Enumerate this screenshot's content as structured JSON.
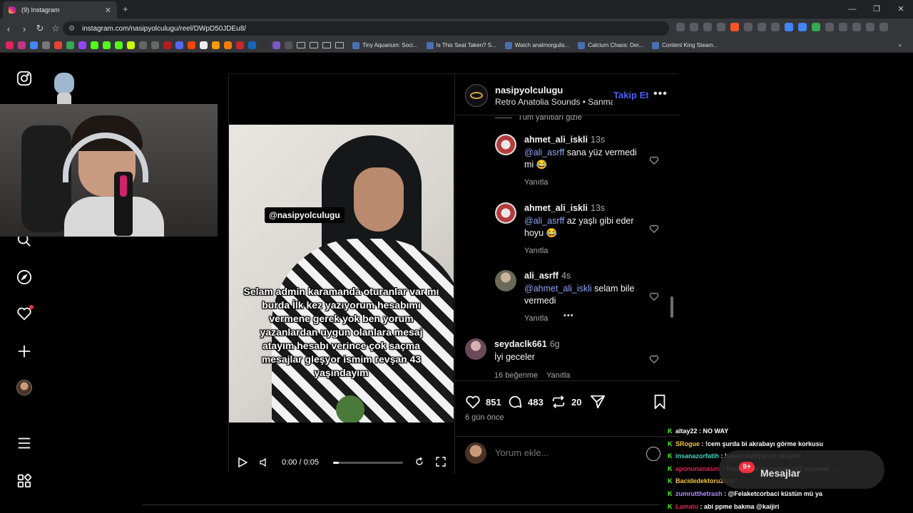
{
  "browser": {
    "tab_title": "(9) Instagram",
    "url": "instagram.com/nasipyolculugu/reel/DWpD50JDEu8/",
    "bookmarks": [
      "Tiny Aquarium: Soci...",
      "Is This Seat Taken? S...",
      "Watch analmorgulis...",
      "Calcium Chaos: Der...",
      "Content King Steam..."
    ]
  },
  "post": {
    "username": "nasipyolculugu",
    "audio": "Retro Anatolia Sounds • Sanma...",
    "follow_label": "Takip Et",
    "watermark": "@nasipyolculugu",
    "caption": "Selam admin karamanda oturanlar var mı burda İlk kez yazıyorum hesabımı vermene gerek yok ben yorum yazanlardan uygun olanlara mesaj atayım hesabı verince çok saçma mesajlar gleşyor ismim revşan 43 yaşındayım",
    "video_time": "0:00 / 0:05",
    "video_progress": 0.08,
    "likes": "851",
    "comments_count": "483",
    "shares": "20",
    "posted_ago": "6 gün önce",
    "comment_placeholder": "Yorum ekle..."
  },
  "comments": {
    "hide_replies": "Tüm yanıtları gizle",
    "reply_label": "Yanıtla",
    "items": [
      {
        "user": "ahmet_ali_iskli",
        "time": "13s",
        "mention": "@ali_asrff",
        "text": " sana yüz vermedi mi 😂"
      },
      {
        "user": "ahmet_ali_iskli",
        "time": "13s",
        "mention": "@ali_asrff",
        "text": " az yaşlı gibi eder hoyu 😂"
      },
      {
        "user": "ali_asrff",
        "time": "4s",
        "mention": "@ahmet_ali_iskli",
        "text": " selam bile vermedi"
      },
      {
        "user": "seydaclk661",
        "time": "6g",
        "mention": "",
        "text": "İyi geceler",
        "likes": "16 beğenme"
      }
    ]
  },
  "messages": {
    "label": "Mesajlar",
    "badge": "9+"
  },
  "chat": [
    {
      "user": "altay22",
      "msg": ": NO WAY",
      "color": "#ffffff"
    },
    {
      "user": "SRogue",
      "msg": ": !cem şurda bi akrabayı görme korkusu",
      "color": "#f5c542"
    },
    {
      "user": "insanazorfatih",
      "msg": ": hasan ilahiyat mı okuyon",
      "color": "#4bd5c4"
    },
    {
      "user": "aponunanasını",
      "msg": ": franis abie ne zaman ck3 oynacaz ...",
      "color": "#e0245e"
    },
    {
      "user": "Bacidedektoru2000",
      "msg": ":",
      "color": "#f5c542"
    },
    {
      "user": "zumrutthetrash",
      "msg": ": @Felaketcorbaci küstün mü ya",
      "color": "#b388ff"
    },
    {
      "user": "Lamatu",
      "msg": ": abi ppme bakma @kaijiri",
      "color": "#e0245e"
    }
  ]
}
